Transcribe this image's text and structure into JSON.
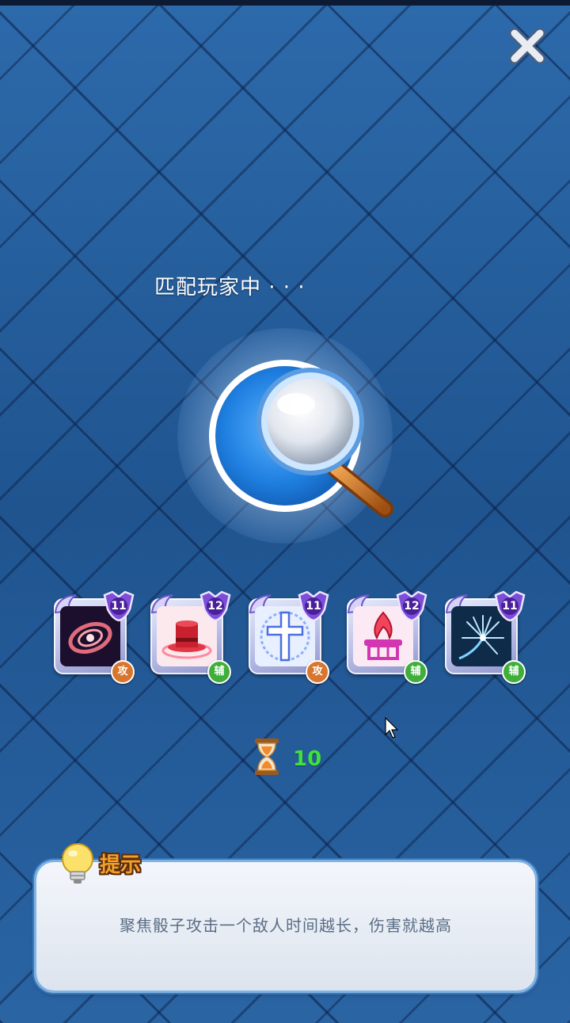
{
  "status": {
    "matching_text": "匹配玩家中 · · ·"
  },
  "close_button": {
    "icon": "close-icon"
  },
  "search": {
    "icon": "magnifier-icon"
  },
  "dice_deck": [
    {
      "icon": "galaxy-dice-icon",
      "level": "11",
      "type_label": "攻",
      "type": "attack"
    },
    {
      "icon": "red-hat-dice-icon",
      "level": "12",
      "type_label": "辅",
      "type": "support"
    },
    {
      "icon": "cross-dice-icon",
      "level": "11",
      "type_label": "攻",
      "type": "attack"
    },
    {
      "icon": "flame-altar-dice-icon",
      "level": "12",
      "type_label": "辅",
      "type": "support"
    },
    {
      "icon": "spark-dice-icon",
      "level": "11",
      "type_label": "辅",
      "type": "support"
    }
  ],
  "timer": {
    "icon": "hourglass-icon",
    "value": "10"
  },
  "tip": {
    "icon": "lightbulb-icon",
    "title": "提示",
    "text": "聚焦骰子攻击一个敌人时间越长，伤害就越高"
  },
  "colors": {
    "background": "#245a96",
    "timer": "#3ee23a",
    "tip_title": "#f2a02a",
    "attack_badge": "#d8762e",
    "support_badge": "#3fae3a"
  }
}
